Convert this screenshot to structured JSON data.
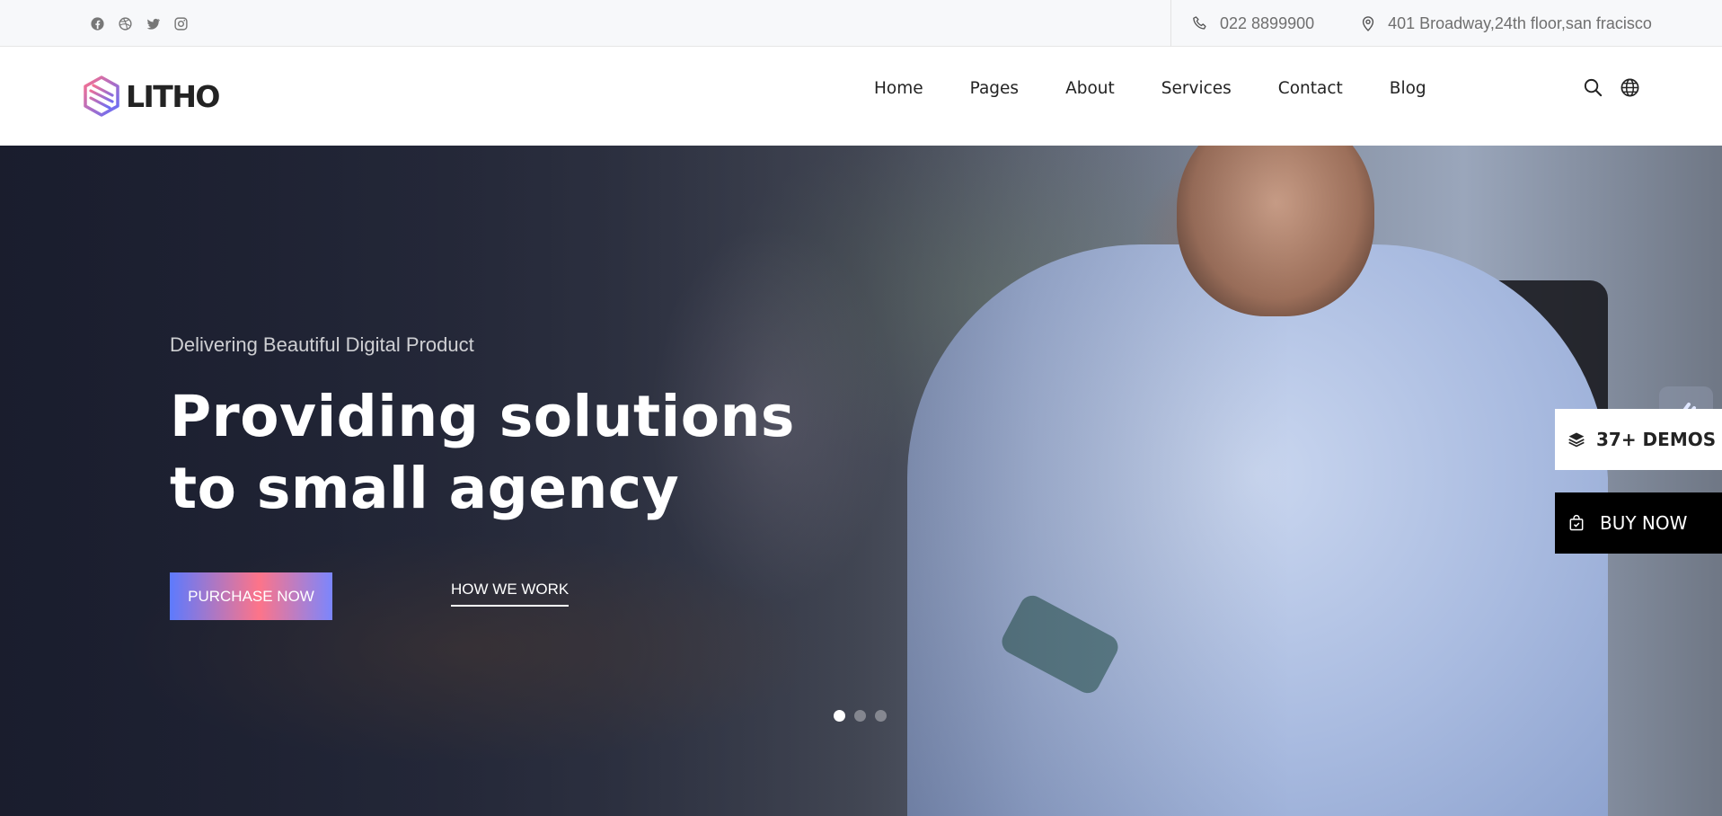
{
  "topbar": {
    "social_icons": [
      "facebook-icon",
      "dribbble-icon",
      "twitter-icon",
      "instagram-icon"
    ],
    "phone": "022 8899900",
    "address": "401 Broadway,24th floor,san fracisco"
  },
  "header": {
    "logo_text": "LITHO",
    "nav": [
      "Home",
      "Pages",
      "About",
      "Services",
      "Contact",
      "Blog"
    ],
    "icons": [
      "search-icon",
      "globe-icon"
    ]
  },
  "hero": {
    "subtitle": "Delivering Beautiful Digital Product",
    "title_line1": "Providing solutions",
    "title_line2": "to small agency",
    "primary_button": "PURCHASE NOW",
    "secondary_button": "HOW WE WORK",
    "slides_total": 3,
    "active_slide": 1
  },
  "side": {
    "demos_label": "37+ DEMOS",
    "buy_label": "BUY NOW"
  },
  "colors": {
    "brand_gradient_start": "#5d7afe",
    "brand_gradient_mid": "#fd7489",
    "text_dark": "#232323",
    "topbar_bg": "#f7f8fa"
  }
}
